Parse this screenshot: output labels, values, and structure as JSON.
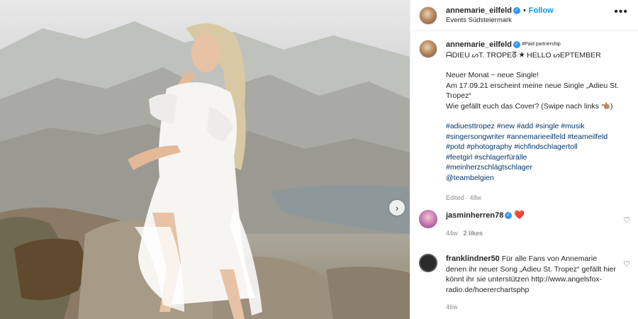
{
  "post": {
    "username": "annemarie_eilfeld",
    "follow_label": "Follow",
    "location": "Events Südsteiermark",
    "more_label": "•••",
    "next_label": "›"
  },
  "caption": {
    "username": "annemarie_eilfeld",
    "small_tag": "#Paid partnership",
    "title_line": "ᗩDIEU ᔕT. TROPEᘔ ★ HELLO ᔕEPTEMBER",
    "lines": [
      "Neuer Monat ~ neue Single!",
      "Am 17.09.21 erscheint meine neue Single „Adieu St. Tropez“",
      "Wie gefällt euch das Cover? (Swipe nach links 👈🏽)"
    ],
    "hashtags": [
      "#adiuesttropez #new #add #single #musik",
      "#singersongwriter #annemarieeilfeld #teameilfeld",
      "#potd #photography #ichfindschlagertoll",
      "#feetgirl #schlagerfürälle",
      "#meinherzschlägtschlager",
      "@teambelgien"
    ],
    "edited": "Edited · 48w"
  },
  "comments": [
    {
      "username": "jasminherren78",
      "text": "",
      "emoji": "❤️",
      "age": "44w",
      "likes": "2 likes"
    },
    {
      "username": "franklindner50",
      "text": "Für alle Fans von Annemarie denen ihr neuer Song „Adieu St. Tropez“ gefällt hier könnt ihr sie unterstützen http://www.angelsfox-radio.de/hoererchartsphp",
      "age": "46w"
    }
  ],
  "colors": {
    "link": "#00376b",
    "follow": "#0095f6",
    "verified": "#3897f0",
    "heart": "#ed4956"
  }
}
